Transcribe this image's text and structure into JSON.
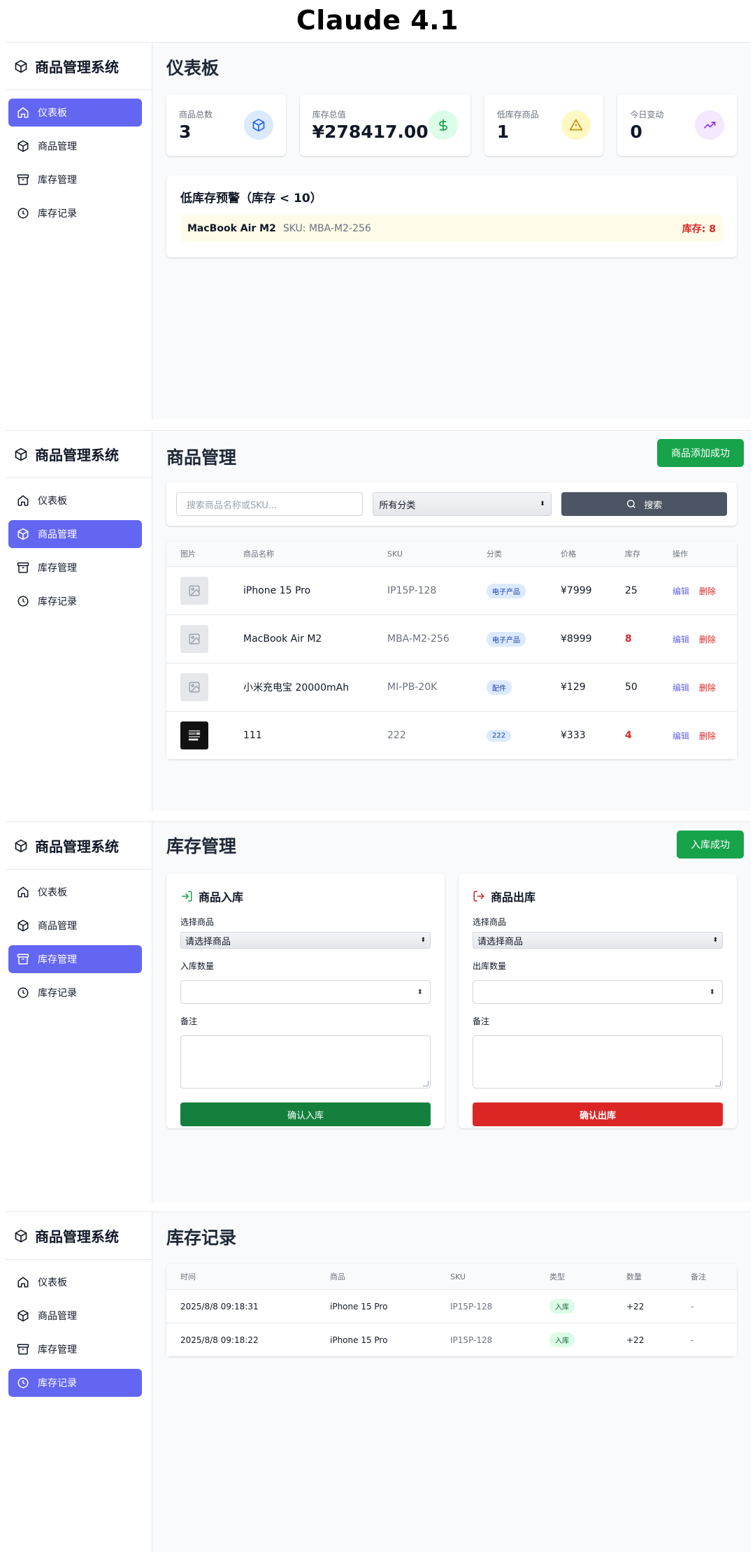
{
  "banner": {
    "title": "Claude 4.1"
  },
  "app": {
    "title": "商品管理系统"
  },
  "nav": [
    "仪表板",
    "商品管理",
    "库存管理",
    "库存记录"
  ],
  "dashboard": {
    "title": "仪表板",
    "stats": [
      {
        "label": "商品总数",
        "value": "3",
        "icon": "cube-icon",
        "bg": "#dbeafe",
        "color": "#2563eb"
      },
      {
        "label": "库存总值",
        "value": "¥278417.00",
        "icon": "dollar-icon",
        "bg": "#dcfce7",
        "color": "#16a34a"
      },
      {
        "label": "低库存商品",
        "value": "1",
        "icon": "warning-icon",
        "bg": "#fef9c3",
        "color": "#ca8a04"
      },
      {
        "label": "今日变动",
        "value": "0",
        "icon": "trend-up-icon",
        "bg": "#f3e8ff",
        "color": "#9333ea"
      }
    ],
    "alert": {
      "title": "低库存预警（库存 < 10）",
      "item_name": "MacBook Air M2",
      "item_sku": "SKU: MBA-M2-256",
      "item_stock": "库存: 8"
    }
  },
  "products": {
    "title": "商品管理",
    "toast": "商品添加成功",
    "search_placeholder": "搜索商品名称或SKU...",
    "category_select": "所有分类",
    "search_button": "搜索",
    "columns": [
      "图片",
      "商品名称",
      "SKU",
      "分类",
      "价格",
      "库存",
      "操作"
    ],
    "rows": [
      {
        "name": "iPhone 15 Pro",
        "sku": "IP15P-128",
        "category": "电子产品",
        "price": "¥7999",
        "stock": "25",
        "low": false,
        "photo": false
      },
      {
        "name": "MacBook Air M2",
        "sku": "MBA-M2-256",
        "category": "电子产品",
        "price": "¥8999",
        "stock": "8",
        "low": true,
        "photo": false
      },
      {
        "name": "小米充电宝 20000mAh",
        "sku": "MI-PB-20K",
        "category": "配件",
        "price": "¥129",
        "stock": "50",
        "low": false,
        "photo": false
      },
      {
        "name": "111",
        "sku": "222",
        "category": "222",
        "price": "¥333",
        "stock": "4",
        "low": true,
        "photo": true
      }
    ],
    "edit": "编辑",
    "delete": "删除"
  },
  "inventory": {
    "title": "库存管理",
    "toast": "入库成功",
    "in": {
      "title": "商品入库",
      "select_label": "选择商品",
      "select_value": "请选择商品",
      "qty_label": "入库数量",
      "note_label": "备注",
      "button": "确认入库"
    },
    "out": {
      "title": "商品出库",
      "select_label": "选择商品",
      "select_value": "请选择商品",
      "qty_label": "出库数量",
      "note_label": "备注",
      "button": "确认出库"
    }
  },
  "records": {
    "title": "库存记录",
    "columns": [
      "时间",
      "商品",
      "SKU",
      "类型",
      "数量",
      "备注"
    ],
    "rows": [
      {
        "time": "2025/8/8 09:18:31",
        "product": "iPhone 15 Pro",
        "sku": "IP15P-128",
        "type": "入库",
        "qty": "+22",
        "note": "-"
      },
      {
        "time": "2025/8/8 09:18:22",
        "product": "iPhone 15 Pro",
        "sku": "IP15P-128",
        "type": "入库",
        "qty": "+22",
        "note": "-"
      }
    ]
  }
}
